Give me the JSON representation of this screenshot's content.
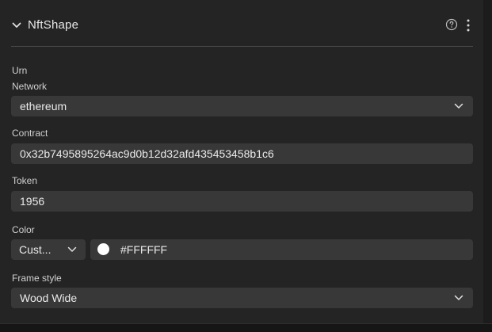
{
  "panel": {
    "title": "NftShape",
    "icons": {
      "collapse": "chevron-down-icon",
      "help": "help-circle-icon",
      "more": "more-vertical-icon"
    }
  },
  "urn": {
    "label": "Urn"
  },
  "network": {
    "label": "Network",
    "value": "ethereum"
  },
  "contract": {
    "label": "Contract",
    "value": "0x32b7495895264ac9d0b12d32afd435453458b1c6"
  },
  "token": {
    "label": "Token",
    "value": "1956"
  },
  "color": {
    "label": "Color",
    "mode_value": "Cust...",
    "hex_value": "#FFFFFF",
    "swatch_color": "#FFFFFF"
  },
  "frame_style": {
    "label": "Frame style",
    "value": "Wood Wide"
  },
  "colors": {
    "panel_bg": "#242424",
    "field_bg": "#383838",
    "text": "#eaeaea",
    "label_text": "#d0d0d0"
  }
}
